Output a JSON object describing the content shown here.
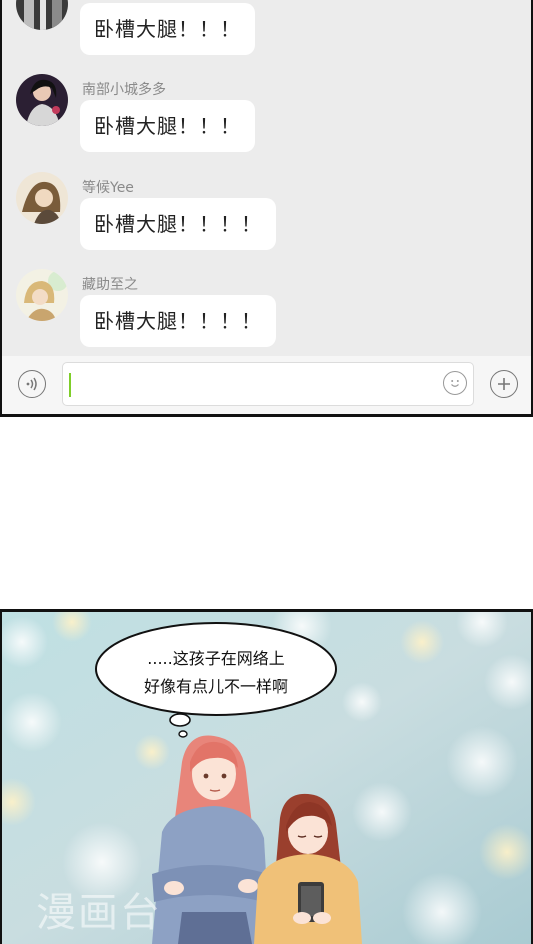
{
  "chat": {
    "messages": [
      {
        "username": "",
        "text": "卧槽大腿！！！"
      },
      {
        "username": "南部小城多多",
        "text": "卧槽大腿！！！"
      },
      {
        "username": "等候Yee",
        "text": "卧槽大腿！！！！"
      },
      {
        "username": "藏助至之",
        "text": "卧槽大腿！！！！"
      }
    ]
  },
  "input": {
    "voice_icon": "voice-icon",
    "emoji_icon": "emoji-icon",
    "add_icon": "plus-icon",
    "caret_color": "#7fce2a"
  },
  "comic": {
    "speech_line1": ".....这孩子在网络上",
    "speech_line2": "好像有点儿不一样啊",
    "watermark": "漫画台"
  }
}
